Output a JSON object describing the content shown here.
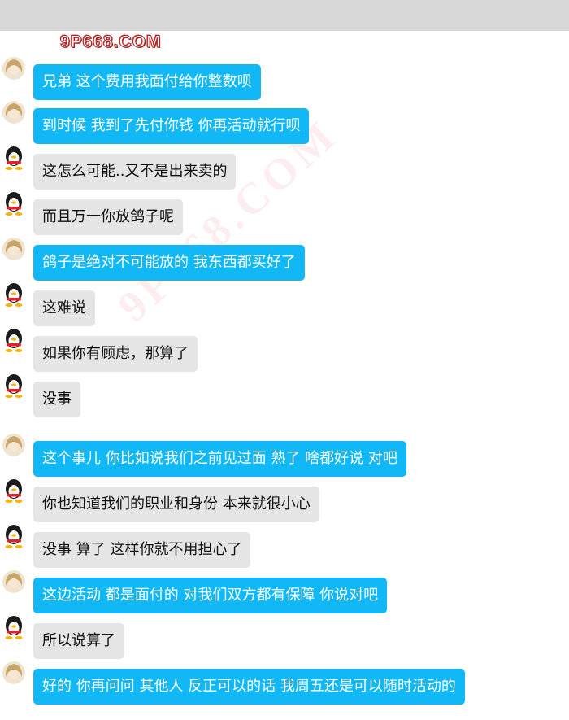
{
  "header": {
    "logo_text": "9P668.COM",
    "watermark_text": "9P668.COM"
  },
  "colors": {
    "self_bubble": "#12b7f5",
    "other_bubble": "#e5e5e5",
    "top_bar": "#d8d8d8"
  },
  "messages": [
    {
      "sender": "self",
      "avatar": "girl-avatar-icon",
      "text": "兄弟  这个费用我面付给你整数呗"
    },
    {
      "sender": "self",
      "avatar": "girl-avatar-icon",
      "text": "到时候 我到了先付你钱 你再活动就行呗"
    },
    {
      "sender": "other",
      "avatar": "penguin-avatar-icon",
      "text": "这怎么可能..又不是出来卖的"
    },
    {
      "sender": "other",
      "avatar": "penguin-avatar-icon",
      "text": "而且万一你放鸽子呢"
    },
    {
      "sender": "self",
      "avatar": "girl-avatar-icon",
      "text": "鸽子是绝对不可能放的 我东西都买好了"
    },
    {
      "sender": "other",
      "avatar": "penguin-avatar-icon",
      "text": "这难说"
    },
    {
      "sender": "other",
      "avatar": "penguin-avatar-icon",
      "text": "如果你有顾虑，那算了"
    },
    {
      "sender": "other",
      "avatar": "penguin-avatar-icon",
      "text": "没事"
    },
    {
      "sender": "self",
      "avatar": "girl-avatar-icon",
      "text": "这个事儿 你比如说我们之前见过面 熟了  啥都好说 对吧"
    },
    {
      "sender": "other",
      "avatar": "penguin-avatar-icon",
      "text": "你也知道我们的职业和身份 本来就很小心"
    },
    {
      "sender": "other",
      "avatar": "penguin-avatar-icon",
      "text": "没事 算了 这样你就不用担心了"
    },
    {
      "sender": "self",
      "avatar": "girl-avatar-icon",
      "text": "这边活动  都是面付的  对我们双方都有保障 你说对吧"
    },
    {
      "sender": "other",
      "avatar": "penguin-avatar-icon",
      "text": "所以说算了"
    },
    {
      "sender": "self",
      "avatar": "girl-avatar-icon",
      "text": "好的  你再问问  其他人  反正可以的话 我周五还是可以随时活动的"
    }
  ]
}
